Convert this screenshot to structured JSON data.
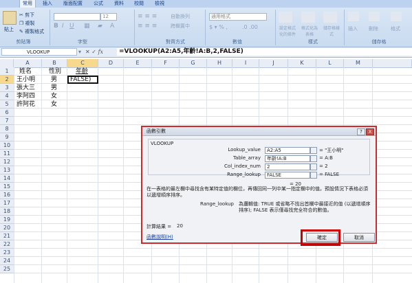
{
  "ribbon": {
    "tabs": [
      "常用",
      "插入",
      "版面配置",
      "公式",
      "資料",
      "校閱",
      "檢視"
    ],
    "clipboard": {
      "paste": "貼上",
      "cut": "剪下",
      "copy": "複製",
      "format_painter": "複製格式",
      "label": "剪貼簿"
    },
    "font": {
      "label": "字型",
      "size": "12"
    },
    "alignment": {
      "label": "對齊方式",
      "wrap": "自動換列",
      "merge": "跨欄置中"
    },
    "number": {
      "label": "數值",
      "format": "通用格式"
    },
    "styles": {
      "label": "樣式",
      "conditional": "設定格式化的條件",
      "table": "格式化為表格",
      "cell": "儲存格樣式"
    },
    "cells": {
      "label": "儲存格",
      "insert": "插入",
      "delete": "刪除",
      "format": "格式"
    }
  },
  "formula_bar": {
    "name_box": "VLOOKUP",
    "fx": "fx",
    "formula": "=VLOOKUP(A2:A5,年齡!A:B,2,FALSE)"
  },
  "sheet": {
    "columns": [
      "A",
      "B",
      "C",
      "D",
      "E",
      "F",
      "G",
      "H",
      "I",
      "J",
      "K",
      "L",
      "M"
    ],
    "rows": [
      "1",
      "2",
      "3",
      "4",
      "5",
      "6",
      "7",
      "8",
      "9",
      "10",
      "11",
      "12",
      "13",
      "14",
      "15",
      "16",
      "17",
      "18",
      "19",
      "20",
      "21",
      "22",
      "23",
      "24",
      "25"
    ],
    "cells": {
      "A1": "姓名",
      "B1": "性別",
      "C1": "年齡",
      "A2": "王小明",
      "B2": "男",
      "C2": "FALSE)",
      "A3": "張大三",
      "B3": "男",
      "A4": "李阿四",
      "B4": "女",
      "A5": "許阿花",
      "B5": "女"
    }
  },
  "dialog": {
    "title": "函數引數",
    "help": "?",
    "close": "X",
    "function_name": "VLOOKUP",
    "args": [
      {
        "label": "Lookup_value",
        "value": "A2:A5",
        "result": "= \"王小明\""
      },
      {
        "label": "Table_array",
        "value": "年齡!A:B",
        "result": "= A:B"
      },
      {
        "label": "Col_index_num",
        "value": "2",
        "result": "= 2"
      },
      {
        "label": "Range_lookup",
        "value": "FALSE",
        "result": "= FALSE"
      }
    ],
    "formula_result_inline": "= 20",
    "description": "在一表格的最左欄中尋找含有某特定值的欄位，再傳回同一列中某一指定欄中的值。預設情況下表格必須以遞增順序排序。",
    "arg_desc_label": "Range_lookup",
    "arg_desc": "為邏輯值: TRUE 或省略不找出首欄中最接近的值 (以遞增順序排序); FALSE 表示僅尋找完全符合的數值。",
    "result_label": "計算結果 =",
    "result_value": "20",
    "help_link": "函數說明(H)",
    "ok": "確定",
    "cancel": "取消"
  }
}
